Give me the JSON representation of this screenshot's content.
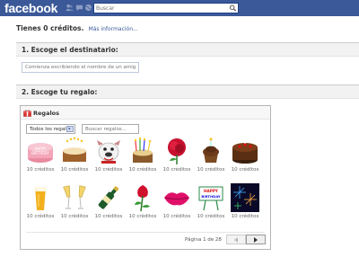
{
  "header": {
    "logo": "facebook",
    "search_placeholder": "Buscar",
    "icons": [
      "friends-icon",
      "messages-icon",
      "globe-notifications-icon",
      "search-magnifier-icon"
    ]
  },
  "credits": {
    "text": "Tienes 0 créditos.",
    "more_info": "Más información..."
  },
  "step1": {
    "title": "1. Escoge el destinatario:",
    "placeholder": "Comienza escribiendo el nombre de un amigo"
  },
  "step2": {
    "title": "2. Escoge tu regalo:"
  },
  "gifts": {
    "panel_title": "Regalos",
    "category": "Todos los regalos",
    "search_placeholder": "Buscar regalos...",
    "items": [
      {
        "name": "happy-birthday-cake",
        "price": "10 créditos"
      },
      {
        "name": "candles-cake",
        "price": "10 créditos"
      },
      {
        "name": "bulldog",
        "price": "10 créditos"
      },
      {
        "name": "party-cake",
        "price": "10 créditos"
      },
      {
        "name": "red-rose",
        "price": "10 créditos"
      },
      {
        "name": "cupcake",
        "price": "10 créditos"
      },
      {
        "name": "chocolate-cake",
        "price": "10 créditos"
      },
      {
        "name": "beer",
        "price": "10 créditos"
      },
      {
        "name": "champagne-glasses",
        "price": "10 créditos"
      },
      {
        "name": "champagne-bottle",
        "price": "10 créditos"
      },
      {
        "name": "rose-bud",
        "price": "10 créditos"
      },
      {
        "name": "lips-kiss",
        "price": "10 créditos"
      },
      {
        "name": "happy-birthday-sign",
        "price": "10 créditos"
      },
      {
        "name": "fireworks",
        "price": "10 créditos"
      }
    ],
    "page_label": "Página 1 de 28"
  },
  "colors": {
    "brand": "#3b5998",
    "link": "#3b5998"
  }
}
